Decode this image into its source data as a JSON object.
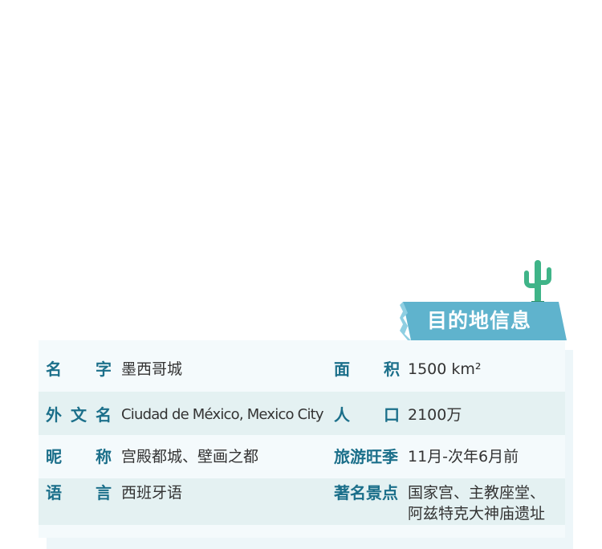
{
  "banner": {
    "title": "目的地信息"
  },
  "rows": [
    {
      "left": {
        "label_chars": [
          "名",
          "字"
        ],
        "value": "墨西哥城"
      },
      "right": {
        "label_chars": [
          "面",
          "积"
        ],
        "value": "1500 km²"
      }
    },
    {
      "left": {
        "label_chars": [
          "外",
          "文",
          "名"
        ],
        "value": "Ciudad de México, Mexico City"
      },
      "right": {
        "label_chars": [
          "人",
          "口"
        ],
        "value": "2100万"
      }
    },
    {
      "left": {
        "label_chars": [
          "昵",
          "称"
        ],
        "value": "宫殿都城、壁画之都"
      },
      "right": {
        "label": "旅游旺季",
        "value": "11月-次年6月前"
      }
    },
    {
      "left": {
        "label_chars": [
          "语",
          "言"
        ],
        "value": "西班牙语"
      },
      "right": {
        "label": "著名景点",
        "value_line1": "国家宫、主教座堂、",
        "value_line2": "阿兹特克大神庙遗址"
      }
    }
  ],
  "colors": {
    "banner": "#5fb3cd",
    "label": "#1b6f8a",
    "value": "#333333",
    "row_alt": "#e4f1f2",
    "cactus": "#3fb488"
  }
}
